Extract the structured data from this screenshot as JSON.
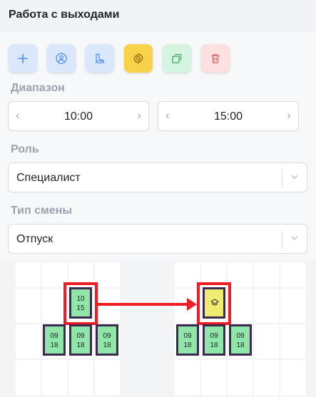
{
  "header": {
    "title": "Работа с выходами"
  },
  "toolbar": [
    {
      "name": "add-button",
      "icon": "plus-icon",
      "bg": "#dbe8fb",
      "color": "#4d8ef0"
    },
    {
      "name": "assign-user-button",
      "icon": "user-circle-icon",
      "bg": "#dbe8fb",
      "color": "#4d8ef0"
    },
    {
      "name": "boot-button",
      "icon": "boot-icon",
      "bg": "#dbe8fb",
      "color": "#4d8ef0"
    },
    {
      "name": "settings-button",
      "icon": "gear-icon",
      "bg": "#f9d24a",
      "color": "#8a6a00"
    },
    {
      "name": "copy-button",
      "icon": "copy-icon",
      "bg": "#d6f5e1",
      "color": "#3aa865"
    },
    {
      "name": "delete-button",
      "icon": "trash-icon",
      "bg": "#fde0e0",
      "color": "#e06060"
    }
  ],
  "range": {
    "label": "Диапазон",
    "start": "10:00",
    "end": "15:00"
  },
  "role": {
    "label": "Роль",
    "value": "Специалист"
  },
  "shift_type": {
    "label": "Тип смены",
    "value": "Отпуск"
  },
  "schedule": {
    "left": {
      "top_shift": {
        "start": "10",
        "end": "15"
      },
      "bottom_shifts": [
        {
          "start": "09",
          "end": "18"
        },
        {
          "start": "09",
          "end": "18"
        },
        {
          "start": "09",
          "end": "18"
        }
      ]
    },
    "right": {
      "top_shift_icon": "vacation-icon",
      "bottom_shifts": [
        {
          "start": "09",
          "end": "18"
        },
        {
          "start": "09",
          "end": "18"
        },
        {
          "start": "09",
          "end": "18"
        }
      ]
    }
  },
  "colors": {
    "shift_green": "#8fe6a8",
    "shift_yellow": "#f0ec72",
    "highlight_red": "#ee1c24",
    "shift_border": "#3b2a4e"
  }
}
